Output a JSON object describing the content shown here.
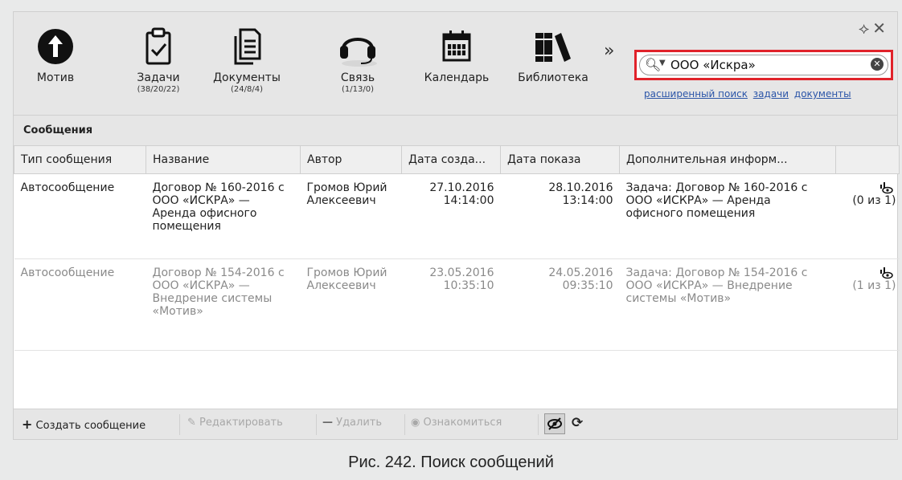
{
  "toolbar": {
    "items": [
      {
        "label": "Мотив",
        "count": ""
      },
      {
        "label": "Задачи",
        "count": "(38/20/22)"
      },
      {
        "label": "Документы",
        "count": "(24/8/4)"
      },
      {
        "label": "Связь",
        "count": "(1/13/0)"
      },
      {
        "label": "Календарь",
        "count": ""
      },
      {
        "label": "Библиотека",
        "count": ""
      }
    ],
    "more": "»",
    "window_controls": "⟡✕"
  },
  "search": {
    "value": "ООО «Искра»",
    "links": [
      "расширенный поиск",
      "задачи",
      "документы"
    ]
  },
  "section": {
    "title": "Сообщения"
  },
  "table": {
    "columns": [
      "Тип сообщения",
      "Название",
      "Автор",
      "Дата созда...",
      "Дата показа",
      "Дополнительная информ...",
      ""
    ],
    "rows": [
      {
        "type": "Автосообщение",
        "name": "Договор № 160-2016 с ООО «ИСКРА» — Аренда офисного помещения",
        "author": "Громов Юрий Алексеевич",
        "created": "27.10.2016 14:14:00",
        "shown": "28.10.2016 13:14:00",
        "info": "Задача: Договор № 160-2016 с ООО «ИСКРА» — Аренда офисного помещения",
        "read": "(0 из 1)"
      },
      {
        "type": "Автосообщение",
        "name": "Договор № 154-2016 с ООО «ИСКРА» — Внедрение системы «Мотив»",
        "author": "Громов Юрий Алексеевич",
        "created": "23.05.2016 10:35:10",
        "shown": "24.05.2016 09:35:10",
        "info": "Задача: Договор № 154-2016 с ООО «ИСКРА» — Внедрение системы «Мотив»",
        "read": "(1 из 1)"
      }
    ]
  },
  "bottombar": {
    "create": "Создать сообщение",
    "edit": "Редактировать",
    "delete": "Удалить",
    "acquaint": "Ознакомиться"
  },
  "caption": "Рис. 242. Поиск сообщений"
}
